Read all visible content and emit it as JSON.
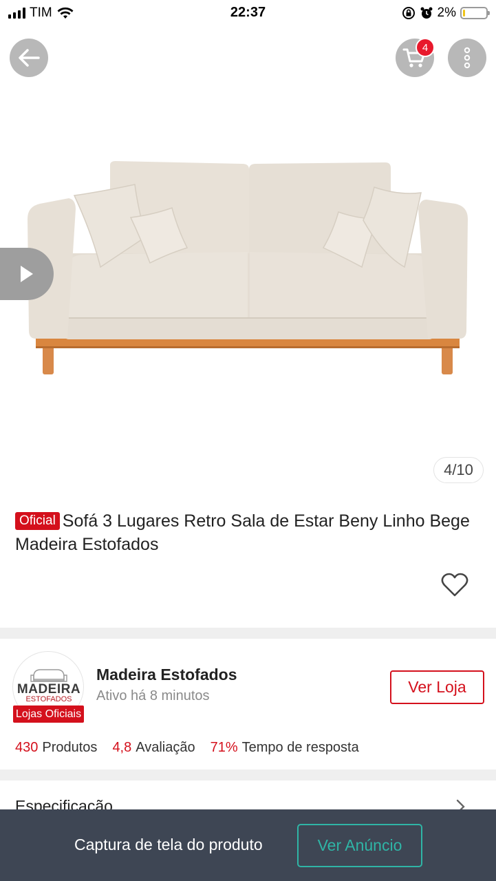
{
  "status_bar": {
    "carrier": "TIM",
    "time": "22:37",
    "battery_percent": "2%",
    "battery_level": 0.02
  },
  "header": {
    "cart_count": "4"
  },
  "gallery": {
    "counter": "4/10"
  },
  "product": {
    "badge": "Oficial",
    "title": "Sofá 3 Lugares Retro Sala de Estar Beny Linho Bege Madeira Estofados"
  },
  "store": {
    "logo_text": "MADEIRA",
    "logo_subtext": "ESTOFADOS",
    "official_tag": "Lojas Oficiais",
    "name": "Madeira Estofados",
    "active_status": "Ativo há 8 minutos",
    "visit_button": "Ver Loja",
    "stats": [
      {
        "value": "430",
        "label": "Produtos"
      },
      {
        "value": "4,8",
        "label": "Avaliação"
      },
      {
        "value": "71%",
        "label": "Tempo de resposta"
      }
    ]
  },
  "specification": {
    "label": "Especificação"
  },
  "bottom_bar": {
    "message": "Captura de tela do produto",
    "action": "Ver Anúncio"
  },
  "colors": {
    "brand_red": "#d4101c",
    "teal": "#2fb5a6",
    "bottom_bar": "#3e4654"
  }
}
